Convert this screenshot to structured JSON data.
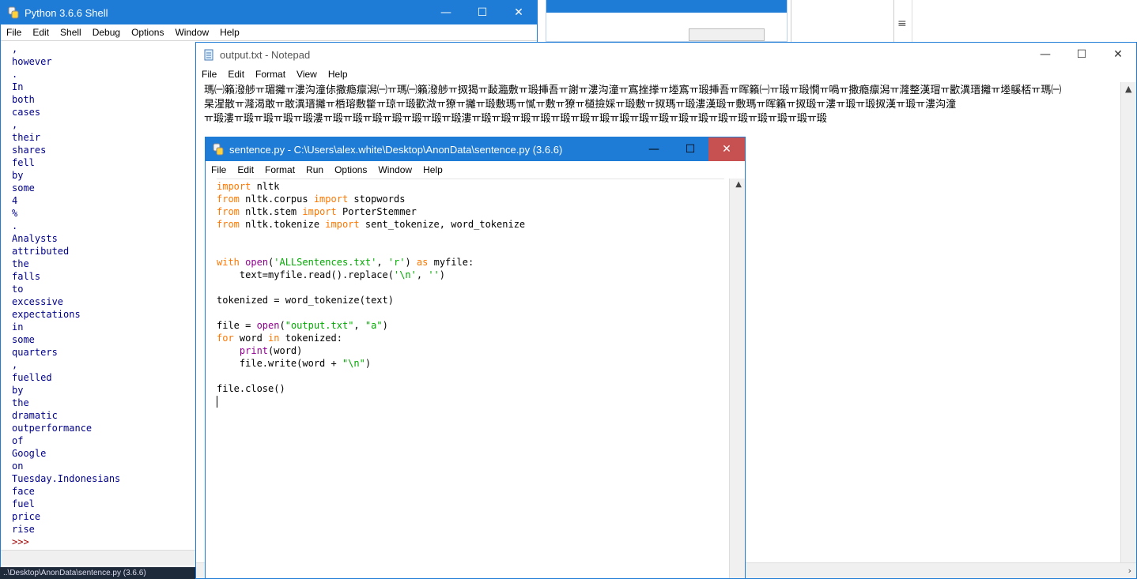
{
  "shell": {
    "title": "Python 3.6.6 Shell",
    "menu": [
      "File",
      "Edit",
      "Shell",
      "Debug",
      "Options",
      "Window",
      "Help"
    ],
    "output_lines": [
      ",",
      "however",
      ".",
      "In",
      "both",
      "cases",
      ",",
      "their",
      "shares",
      "fell",
      "by",
      "some",
      "4",
      "%",
      ".",
      "Analysts",
      "attributed",
      "the",
      "falls",
      "to",
      "excessive",
      "expectations",
      "in",
      "some",
      "quarters",
      ",",
      "fuelled",
      "by",
      "the",
      "dramatic",
      "outperformance",
      "of",
      "Google",
      "on",
      "Tuesday.Indonesians",
      "face",
      "fuel",
      "price",
      "rise"
    ],
    "prompt": ">>>"
  },
  "notepad": {
    "title": "output.txt - Notepad",
    "menu": [
      "File",
      "Edit",
      "Format",
      "View",
      "Help"
    ],
    "text_lines": [
      "瑪㈠籟潑䑰ㅠ瑂攡ㅠ漊沟潼㑐撒瘾癝潟㈠ㅠ瑪㈠籟潑䑰ㅠ㧐猲ㅠ敮瀶敷ㅠ瑖挿吾ㅠ謝ㅠ漊沟潼ㅠ寪挫搼ㅠ堘寪ㅠ瑖挿吾ㅠ晖籟㈠ㅠ瑖ㅠ瑖憪ㅠ喎ㅠ撒瘾癝潟ㅠ漋整漢瑁ㅠ歠潩瑨攡ㅠ堘䳶桮ㅠ瑪㈠",
      "杲湦散ㅠ漋渴敢ㅠ敢潩瑨攡ㅠ桰瑢敷䨆ㅠ琼ㅠ瑖歡溦ㅠ獠ㅠ攡ㅠ瑖敷瑪ㅠ㦐ㅠ敷ㅠ獠ㅠ檤撿婇ㅠ瑖敷ㅠ㧐瑪ㅠ瑖漊漢瑖ㅠ敷瑪ㅠ晖籟ㅠ㧐瑖ㅠ漊ㅠ瑖ㅠ瑖㧐漢ㅠ瑖ㅠ漊沟潼",
      "ㅠ瑖漊ㅠ瑖ㅠ瑖ㅠ瑖ㅠ瑖漊ㅠ瑖ㅠ瑖ㅠ瑖ㅠ瑖ㅠ瑖ㅠ瑖ㅠ瑖漊ㅠ瑖ㅠ瑖ㅠ瑖ㅠ瑖ㅠ瑖ㅠ瑖ㅠ瑖ㅠ瑖ㅠ瑖ㅠ瑖ㅠ瑖ㅠ瑖ㅠ瑖ㅠ瑖ㅠ瑖ㅠ瑖ㅠ瑖ㅠ瑖"
    ]
  },
  "editor": {
    "title": "sentence.py - C:\\Users\\alex.white\\Desktop\\AnonData\\sentence.py (3.6.6)",
    "menu": [
      "File",
      "Edit",
      "Format",
      "Run",
      "Options",
      "Window",
      "Help"
    ],
    "code_lines": [
      [
        {
          "t": "import",
          "c": "kw"
        },
        {
          "t": " nltk",
          "c": ""
        }
      ],
      [
        {
          "t": "from",
          "c": "kw"
        },
        {
          "t": " nltk.corpus ",
          "c": ""
        },
        {
          "t": "import",
          "c": "kw"
        },
        {
          "t": " stopwords",
          "c": ""
        }
      ],
      [
        {
          "t": "from",
          "c": "kw"
        },
        {
          "t": " nltk.stem ",
          "c": ""
        },
        {
          "t": "import",
          "c": "kw"
        },
        {
          "t": " PorterStemmer",
          "c": ""
        }
      ],
      [
        {
          "t": "from",
          "c": "kw"
        },
        {
          "t": " nltk.tokenize ",
          "c": ""
        },
        {
          "t": "import",
          "c": "kw"
        },
        {
          "t": " sent_tokenize, word_tokenize",
          "c": ""
        }
      ],
      [],
      [],
      [
        {
          "t": "with",
          "c": "kw"
        },
        {
          "t": " ",
          "c": ""
        },
        {
          "t": "open",
          "c": "bi"
        },
        {
          "t": "(",
          "c": ""
        },
        {
          "t": "'ALLSentences.txt'",
          "c": "str"
        },
        {
          "t": ", ",
          "c": ""
        },
        {
          "t": "'r'",
          "c": "str"
        },
        {
          "t": ") ",
          "c": ""
        },
        {
          "t": "as",
          "c": "kw"
        },
        {
          "t": " myfile:",
          "c": ""
        }
      ],
      [
        {
          "t": "    text=myfile.read().replace(",
          "c": ""
        },
        {
          "t": "'\\n'",
          "c": "str"
        },
        {
          "t": ", ",
          "c": ""
        },
        {
          "t": "''",
          "c": "str"
        },
        {
          "t": ")",
          "c": ""
        }
      ],
      [],
      [
        {
          "t": "tokenized = word_tokenize(text)",
          "c": ""
        }
      ],
      [],
      [
        {
          "t": "file = ",
          "c": ""
        },
        {
          "t": "open",
          "c": "bi"
        },
        {
          "t": "(",
          "c": ""
        },
        {
          "t": "\"output.txt\"",
          "c": "str"
        },
        {
          "t": ", ",
          "c": ""
        },
        {
          "t": "\"a\"",
          "c": "str"
        },
        {
          "t": ")",
          "c": ""
        }
      ],
      [
        {
          "t": "for",
          "c": "kw"
        },
        {
          "t": " word ",
          "c": ""
        },
        {
          "t": "in",
          "c": "kw"
        },
        {
          "t": " tokenized:",
          "c": ""
        }
      ],
      [
        {
          "t": "    ",
          "c": ""
        },
        {
          "t": "print",
          "c": "bi"
        },
        {
          "t": "(word)",
          "c": ""
        }
      ],
      [
        {
          "t": "    file.write(word + ",
          "c": ""
        },
        {
          "t": "\"\\n\"",
          "c": "str"
        },
        {
          "t": ")",
          "c": ""
        }
      ],
      [],
      [
        {
          "t": "file.close()",
          "c": ""
        }
      ]
    ]
  },
  "taskbar": {
    "text": "..\\Desktop\\AnonData\\sentence.py (3.6.6)"
  },
  "icons": {
    "minimize": "minimize-icon",
    "maximize": "maximize-icon",
    "close": "close-icon"
  },
  "colors": {
    "titlebar_active": "#1e7bd6",
    "close_hover": "#c75050",
    "shell_output": "#00008b",
    "keyword": "#ff7700",
    "string": "#00aa00",
    "builtin": "#900090"
  }
}
